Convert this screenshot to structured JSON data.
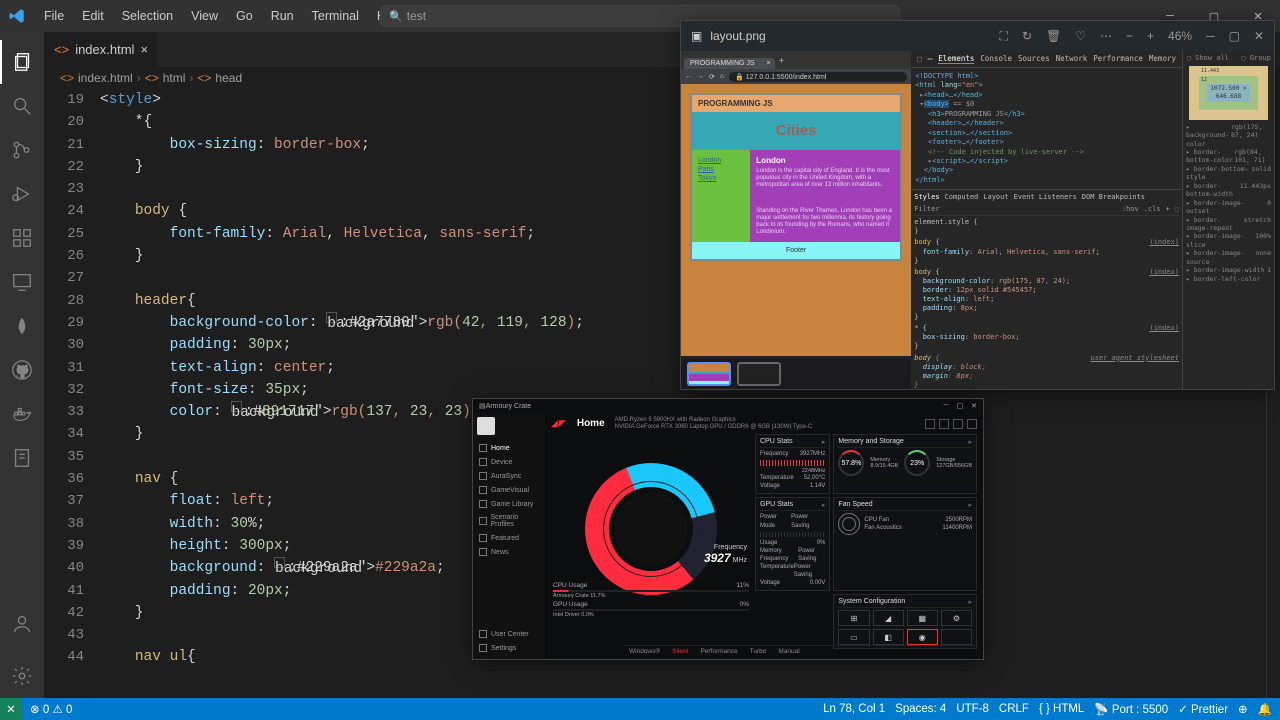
{
  "menus": [
    "File",
    "Edit",
    "Selection",
    "View",
    "Go",
    "Run",
    "Terminal",
    "Help"
  ],
  "search_text": "test",
  "tab": {
    "filename": "index.html"
  },
  "breadcrumb": [
    "index.html",
    "html",
    "head"
  ],
  "gutter_start": 19,
  "code_lines": [
    "<style>",
    "    *{",
    "        box-sizing: border-box;",
    "    }",
    "",
    "    body {",
    "        font-family: Arial, Helvetica, sans-serif;",
    "    }",
    "",
    "    header{",
    "        background-color: ▢rgb(42, 119, 128);",
    "        padding: 30px;",
    "        text-align: center;",
    "        font-size: 35px;",
    "        color: ▢rgb(137, 23, 23);",
    "    }",
    "",
    "    nav {",
    "        float: left;",
    "        width: 30%;",
    "        height: 300px;",
    "        background: ▢#229a2a;",
    "        padding: 20px;",
    "    }",
    "",
    "    nav ul{"
  ],
  "status": {
    "errors": "0",
    "warnings": "0",
    "port": "Port : 5500",
    "ln": "Ln 78, Col 1",
    "spaces": "Spaces: 4",
    "enc": "UTF-8",
    "eol": "CRLF",
    "lang": "HTML",
    "prettier": "Prettier"
  },
  "browser": {
    "title": "layout.png",
    "zoom": "46%",
    "tab": "PROGRAMMING JS",
    "url": "127.0.0.1:5500/index.html",
    "page_title": "PROGRAMMING JS",
    "header": "Cities",
    "nav": [
      "London",
      "Paris",
      "Tokyo"
    ],
    "article_h": "London",
    "article_p1": "London is the capital city of England. It is the most populous city in the United Kingdom, with a metropolitan area of over 13 million inhabitants.",
    "article_p2": "Standing on the River Thames, London has been a major settlement for two millennia, its history going back to its founding by the Romans, who named it Londinium.",
    "footer": "Footer"
  },
  "devtools": {
    "tabs": [
      "Elements",
      "Console",
      "Sources",
      "Network",
      "Performance",
      "Memory"
    ],
    "style_tabs": [
      "Styles",
      "Computed",
      "Layout",
      "Event Listeners",
      "DOM Breakpoints"
    ],
    "filter_row": [
      ":hov",
      ".cls",
      "+",
      "⬚"
    ],
    "boxmodel": {
      "w": "1072.500",
      "h": "646.688",
      "pad": "12",
      "brd": "11.443"
    },
    "rules": [
      {
        "sel": "body",
        "src": "(index)",
        "props": [
          [
            "font-family",
            "Arial, Helvetica, sans-serif"
          ]
        ]
      },
      {
        "sel": "body",
        "src": "(index)",
        "props": [
          [
            "background-color",
            "rgb(175, 87, 24)"
          ],
          [
            "border",
            "12px solid #545457"
          ],
          [
            "text-align",
            "left"
          ],
          [
            "padding",
            "8px"
          ]
        ]
      },
      {
        "sel": "*",
        "src": "(index)",
        "props": [
          [
            "box-sizing",
            "border-box"
          ]
        ]
      },
      {
        "sel": "body",
        "src": "user agent stylesheet",
        "ua": true,
        "props": [
          [
            "display",
            "block"
          ],
          [
            "margin",
            "8px"
          ]
        ]
      }
    ],
    "computed": [
      [
        "background-color",
        "rgb(175, 87, 24)"
      ],
      [
        "border-bottom-color",
        "rgb(84, 101, 71)"
      ],
      [
        "border-bottom-style",
        "solid"
      ],
      [
        "border-bottom-width",
        "11.443px"
      ],
      [
        "border-image-outset",
        "0"
      ],
      [
        "border-image-repeat",
        "stretch"
      ],
      [
        "border-image-slice",
        "100%"
      ],
      [
        "border-image-source",
        "none"
      ],
      [
        "border-image-width",
        "1"
      ],
      [
        "border-left-color",
        ""
      ]
    ]
  },
  "armoury": {
    "title": "Armoury Crate",
    "sidemenu": [
      "Home",
      "Device",
      "AuraSync",
      "GameVisual",
      "Game Library",
      "Scenario Profiles",
      "Featured",
      "News"
    ],
    "sidebottom": [
      "User Center",
      "Settings"
    ],
    "home": "Home",
    "spec1": "AMD Ryzen 9 5900HX with Radeon Graphics",
    "spec2": "NVIDIA GeForce RTX 3060 Laptop GPU / GDDR6 @ 6GB  (130W)  Type-C",
    "freq_label": "Frequency",
    "freq": "3927",
    "freq_unit": "MHz",
    "cpu_panel": {
      "title": "CPU Stats",
      "rows": [
        [
          "Frequency",
          "3927MHz"
        ],
        [
          "Temperature",
          "52.00°C"
        ],
        [
          "Voltage",
          "1.14V"
        ]
      ],
      "avg": "2248MHz"
    },
    "mem_panel": {
      "title": "Memory and Storage",
      "mem_pct": "57.8%",
      "mem_sub": "8.9/15.4GB",
      "ssd_pct": "23%",
      "ssd_sub": "127GB/556GB"
    },
    "fan_panel": {
      "title": "Fan Speed",
      "rows": [
        [
          "CPU Fan",
          "2500RPM"
        ],
        [
          "Fan Acoustics",
          "11400RPM"
        ]
      ]
    },
    "gpu_panel": {
      "title": "GPU Stats",
      "rows": [
        [
          "Power Mode",
          "Power Saving"
        ],
        [
          "Usage",
          "0%"
        ],
        [
          "Memory Frequency",
          "Power Saving"
        ],
        [
          "Temperature",
          "Power Saving"
        ],
        [
          "Voltage",
          "0.00V"
        ]
      ]
    },
    "sys_panel": {
      "title": "System Configuration"
    },
    "cpu_usage": {
      "label": "CPU Usage",
      "val": "11%",
      "sub": "Armoury Crate 11.7%"
    },
    "gpu_usage": {
      "label": "GPU Usage",
      "val": "0%",
      "sub": "Intel Driver 0.0%"
    },
    "modes": [
      "Windows®",
      "Silent",
      "Performance",
      "Turbo",
      "Manual"
    ]
  }
}
